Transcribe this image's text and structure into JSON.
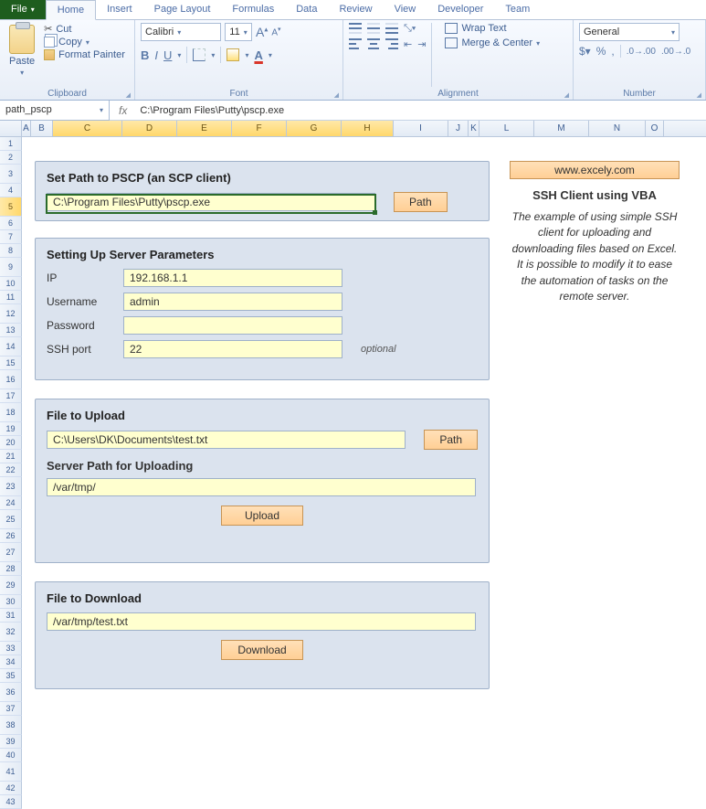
{
  "tabs": {
    "file": "File",
    "home": "Home",
    "insert": "Insert",
    "pageLayout": "Page Layout",
    "formulas": "Formulas",
    "data": "Data",
    "review": "Review",
    "view": "View",
    "developer": "Developer",
    "team": "Team"
  },
  "ribbon": {
    "clipboard": {
      "paste": "Paste",
      "cut": "Cut",
      "copy": "Copy",
      "formatPainter": "Format Painter",
      "groupLabel": "Clipboard"
    },
    "font": {
      "name": "Calibri",
      "size": "11",
      "groupLabel": "Font",
      "b": "B",
      "i": "I",
      "u": "U",
      "a": "A"
    },
    "alignment": {
      "wrap": "Wrap Text",
      "merge": "Merge & Center",
      "groupLabel": "Alignment"
    },
    "number": {
      "format": "General",
      "groupLabel": "Number"
    }
  },
  "nameBox": "path_pscp",
  "fxLabel": "fx",
  "formula": "C:\\Program Files\\Putty\\pscp.exe",
  "columns": [
    "A",
    "B",
    "C",
    "D",
    "E",
    "F",
    "G",
    "H",
    "I",
    "J",
    "K",
    "L",
    "M",
    "N",
    "O"
  ],
  "rows": [
    "1",
    "2",
    "3",
    "4",
    "5",
    "6",
    "7",
    "8",
    "9",
    "10",
    "11",
    "12",
    "13",
    "14",
    "15",
    "16",
    "17",
    "18",
    "19",
    "20",
    "21",
    "22",
    "23",
    "24",
    "25",
    "26",
    "27",
    "28",
    "29",
    "30",
    "31",
    "32",
    "33",
    "34",
    "35",
    "36",
    "37",
    "38",
    "39",
    "40",
    "41",
    "42",
    "43"
  ],
  "panel1": {
    "heading": "Set Path to PSCP (an SCP client)",
    "value": "C:\\Program Files\\Putty\\pscp.exe",
    "pathBtn": "Path"
  },
  "panel2": {
    "heading": "Setting Up Server Parameters",
    "ipLabel": "IP",
    "ip": "192.168.1.1",
    "userLabel": "Username",
    "user": "admin",
    "passLabel": "Password",
    "pass": "",
    "portLabel": "SSH port",
    "port": "22",
    "optional": "optional"
  },
  "panel3": {
    "heading1": "File to Upload",
    "uploadPath": "C:\\Users\\DK\\Documents\\test.txt",
    "pathBtn": "Path",
    "heading2": "Server Path for Uploading",
    "serverPath": "/var/tmp/",
    "uploadBtn": "Upload"
  },
  "panel4": {
    "heading": "File to Download",
    "downloadPath": "/var/tmp/test.txt",
    "downloadBtn": "Download"
  },
  "side": {
    "link": "www.excely.com",
    "title": "SSH Client using VBA",
    "desc": "The example of using simple SSH client for uploading and downloading files based on Excel. It is possible to modify it to ease the automation of tasks on the remote server."
  }
}
